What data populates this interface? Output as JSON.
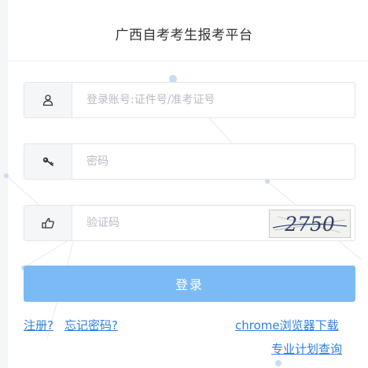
{
  "page": {
    "title": "广西自考考生报考平台"
  },
  "form": {
    "account": {
      "placeholder": "登录账号:证件号/准考证号",
      "icon": "user-icon"
    },
    "password": {
      "placeholder": "密码",
      "icon": "key-icon"
    },
    "captcha": {
      "placeholder": "验证码",
      "icon": "hand-pointer-icon",
      "image_text": "2750"
    },
    "login_label": "登录"
  },
  "links": {
    "register": "注册?",
    "forgot_password": "忘记密码?",
    "chrome_download": "chrome浏览器下载",
    "plan_query": "专业计划查询"
  },
  "colors": {
    "accent": "#7bbaf5",
    "link": "#2f7fe0",
    "border": "#e3e6ea",
    "icon_bg": "#f4f6f8"
  }
}
